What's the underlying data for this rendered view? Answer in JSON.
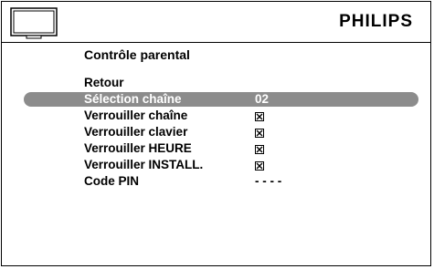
{
  "header": {
    "brand": "PHILIPS",
    "tv_icon": "tv-icon"
  },
  "page": {
    "title": "Contrôle parental"
  },
  "menu": [
    {
      "label": "Retour",
      "value": ""
    },
    {
      "label": "Sélection chaîne",
      "value": "02"
    },
    {
      "label": "Verrouiller chaîne",
      "value": "checked-box"
    },
    {
      "label": "Verrouiller clavier",
      "value": "checked-box"
    },
    {
      "label": "Verrouiller HEURE",
      "value": "checked-box"
    },
    {
      "label": "Verrouiller INSTALL.",
      "value": "checked-box"
    },
    {
      "label": "Code PIN",
      "value": "- - - -"
    }
  ],
  "colors": {
    "selection_bar": "#8c8c8c",
    "text": "#000000",
    "selected_text": "#ffffff"
  }
}
